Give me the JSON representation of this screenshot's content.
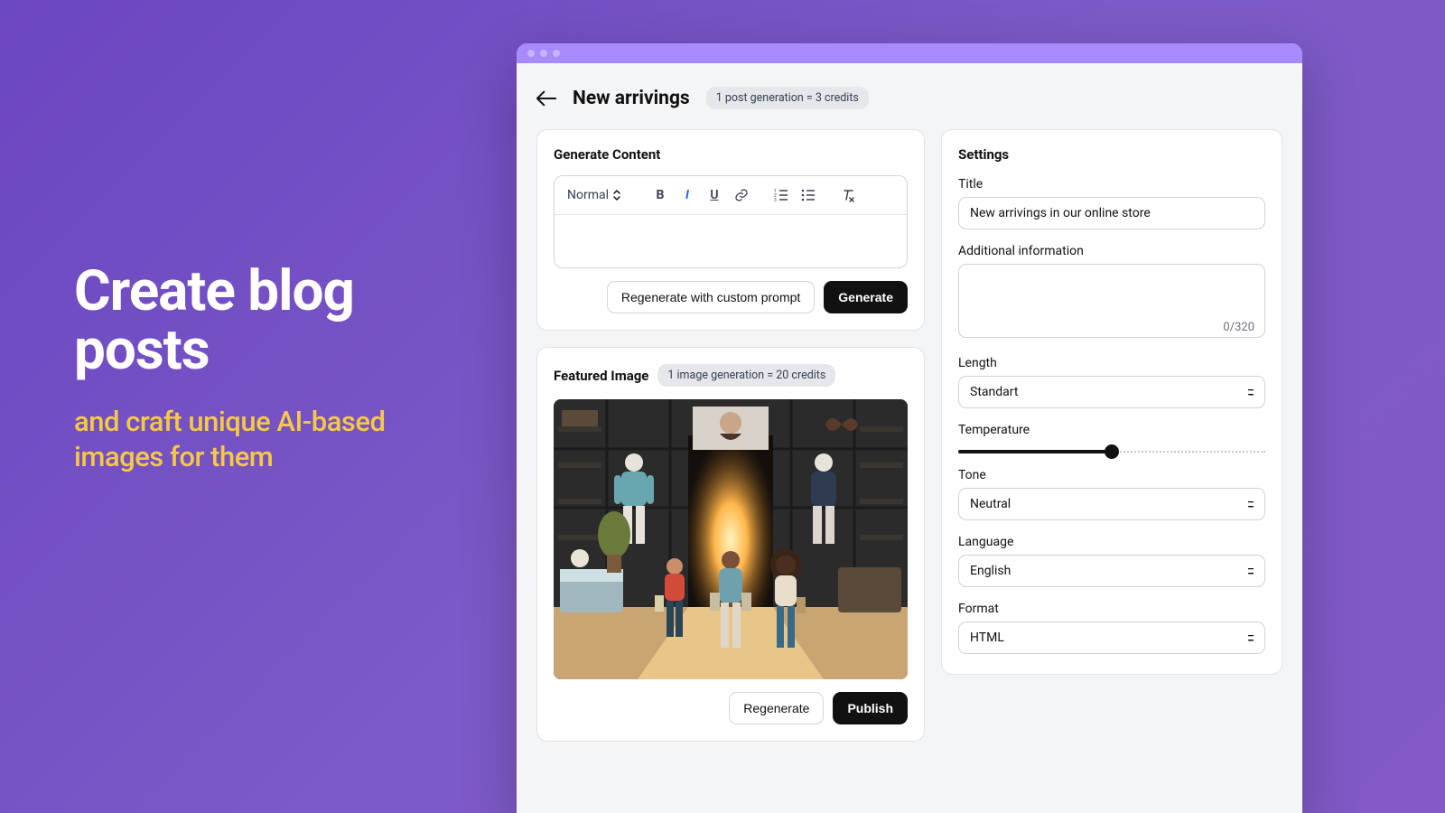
{
  "hero": {
    "title": "Create blog posts",
    "subtitle": "and craft unique AI-based images for them"
  },
  "header": {
    "page_title": "New arrivings",
    "credit_chip": "1 post generation = 3 credits"
  },
  "content_card": {
    "title": "Generate Content",
    "toolbar": {
      "style_label": "Normal"
    },
    "editor_value": "",
    "regenerate_btn": "Regenerate with custom prompt",
    "generate_btn": "Generate"
  },
  "image_card": {
    "title": "Featured Image",
    "credit_chip": "1 image generation = 20 credits",
    "regenerate_btn": "Regenerate",
    "publish_btn": "Publish"
  },
  "settings": {
    "title": "Settings",
    "title_field": {
      "label": "Title",
      "value": "New arrivings in our online store"
    },
    "info_field": {
      "label": "Additional information",
      "value": "",
      "counter": "0/320"
    },
    "length": {
      "label": "Length",
      "value": "Standart"
    },
    "temperature": {
      "label": "Temperature",
      "value": 0.5
    },
    "tone": {
      "label": "Tone",
      "value": "Neutral"
    },
    "language": {
      "label": "Language",
      "value": "English"
    },
    "format": {
      "label": "Format",
      "value": "HTML"
    }
  }
}
